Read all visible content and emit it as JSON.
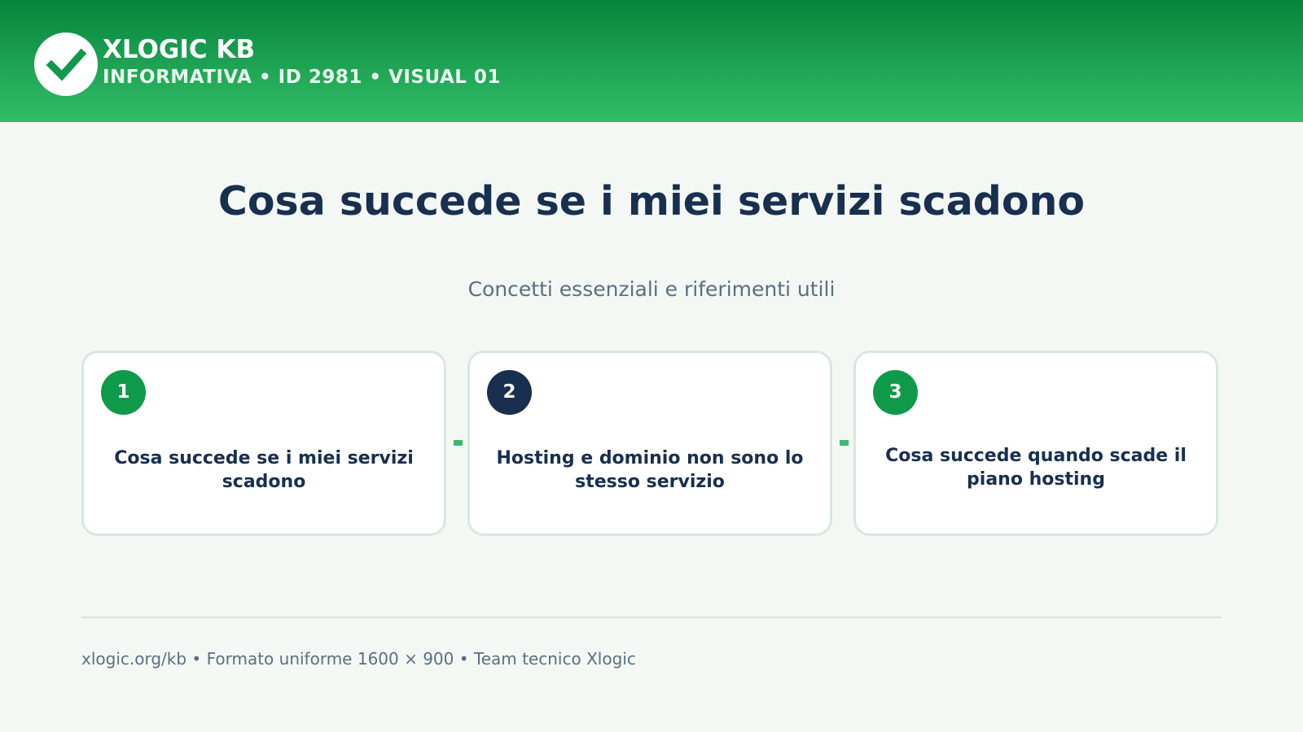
{
  "header": {
    "logo_icon": "check-icon",
    "brand": "XLOGIC KB",
    "subtitle": "INFORMATIVA • ID 2981 • VISUAL 01",
    "gradient_top": "#05853c",
    "gradient_bottom": "#33bd68"
  },
  "main": {
    "title": "Cosa succede se i miei servizi scadono",
    "subtitle": "Concetti essenziali e riferimenti utili"
  },
  "cards": [
    {
      "number": "1",
      "title": "Cosa succede se i miei servizi scadono",
      "badge_color": "#0e9a4a"
    },
    {
      "number": "2",
      "title": "Hosting e dominio non sono lo stesso servizio",
      "badge_color": "#182f4f"
    },
    {
      "number": "3",
      "title": "Cosa succede quando scade il piano hosting",
      "badge_color": "#0e9a4a"
    }
  ],
  "footer": {
    "text": "xlogic.org/kb • Formato uniforme 1600 × 900 • Team tecnico Xlogic"
  },
  "colors": {
    "accent_green": "#0e9a4a",
    "navy": "#182f4f",
    "muted": "#5a6f82",
    "background": "#f4f8f5"
  }
}
